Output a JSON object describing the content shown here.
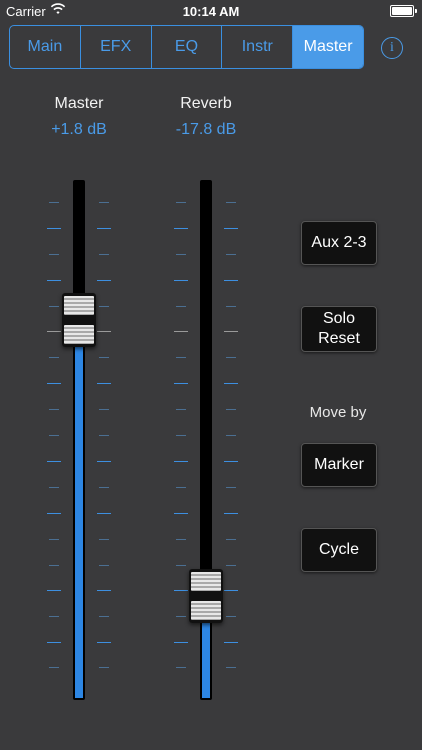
{
  "status_bar": {
    "carrier": "Carrier",
    "time": "10:14 AM"
  },
  "tabs": [
    {
      "label": "Main",
      "active": false
    },
    {
      "label": "EFX",
      "active": false
    },
    {
      "label": "EQ",
      "active": false
    },
    {
      "label": "Instr",
      "active": false
    },
    {
      "label": "Master",
      "active": true
    }
  ],
  "info_button": {
    "glyph": "i"
  },
  "channels": [
    {
      "name": "Master",
      "value": "+1.8 dB",
      "level_fraction": 0.73
    },
    {
      "name": "Reverb",
      "value": "-17.8 dB",
      "level_fraction": 0.2
    }
  ],
  "buttons": {
    "aux": "Aux 2-3",
    "solo_reset_line1": "Solo",
    "solo_reset_line2": "Reset",
    "move_by_label": "Move by",
    "marker": "Marker",
    "cycle": "Cycle"
  },
  "colors": {
    "accent": "#4a9be8",
    "background": "#3a3a3c",
    "fader_fill": "#2d86e3"
  }
}
